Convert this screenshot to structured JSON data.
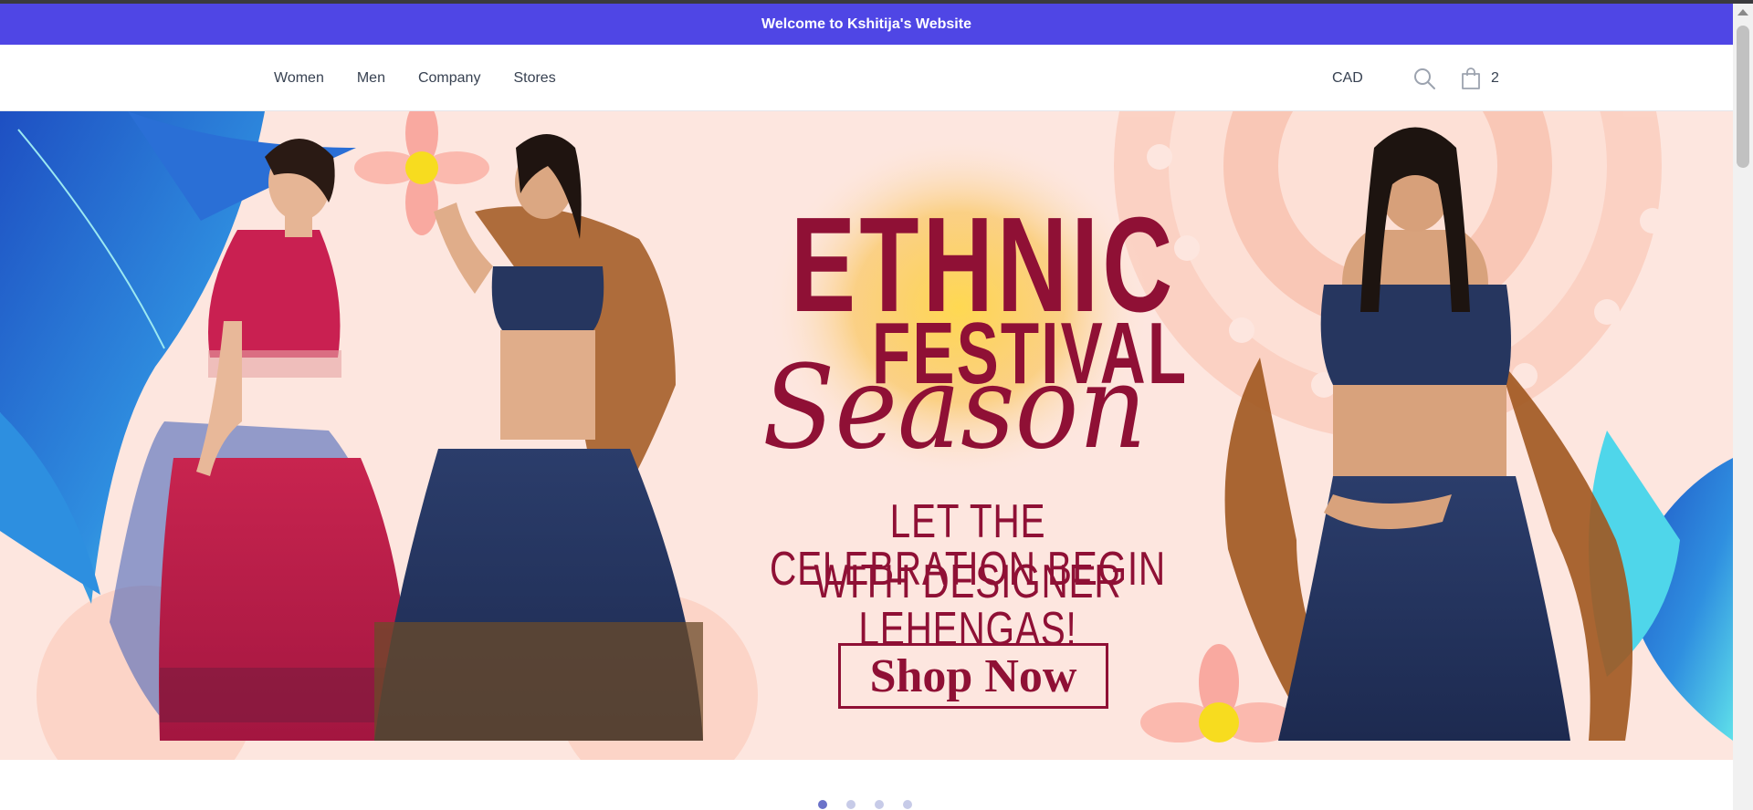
{
  "announcement": {
    "text": "Welcome to Kshitija's Website"
  },
  "nav": {
    "links": [
      {
        "label": "Women"
      },
      {
        "label": "Men"
      },
      {
        "label": "Company"
      },
      {
        "label": "Stores"
      }
    ],
    "currency": "CAD",
    "search_icon": "search-icon",
    "cart_icon": "shopping-bag-icon",
    "cart_count": "2"
  },
  "hero": {
    "title_line1": "ETHNIC",
    "title_line2": "FESTIVAL",
    "title_line3": "Season",
    "subtitle_line1": "LET THE CELEBRATION BEGIN",
    "subtitle_line2": "WITH DESIGNER LEHENGAS!",
    "cta_label": "Shop Now"
  },
  "carousel": {
    "slide_count": 4,
    "active_index": 0
  },
  "colors": {
    "announcement_bg": "#4f46e5",
    "hero_accent": "#8f1035",
    "hero_bg": "#fde8e0"
  }
}
